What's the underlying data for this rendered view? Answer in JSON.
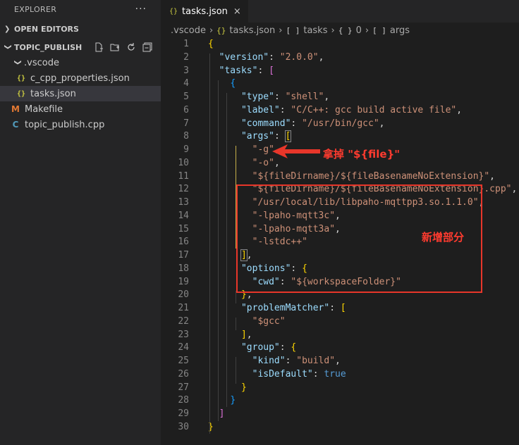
{
  "sidebar": {
    "title": "EXPLORER",
    "more": "···",
    "open_editors": "OPEN EDITORS",
    "project": "TOPIC_PUBLISH",
    "tree": [
      {
        "label": ".vscode",
        "type": "folder"
      },
      {
        "label": "c_cpp_properties.json",
        "type": "json"
      },
      {
        "label": "tasks.json",
        "type": "json"
      },
      {
        "label": "Makefile",
        "type": "makefile"
      },
      {
        "label": "topic_publish.cpp",
        "type": "cpp"
      }
    ]
  },
  "tab": {
    "label": "tasks.json",
    "close": "×"
  },
  "breadcrumb": {
    "folder": ".vscode",
    "file": "tasks.json",
    "tasks": "tasks",
    "index": "0",
    "args": "args"
  },
  "icons": {
    "json": "{}",
    "array": "[ ]",
    "obj": "{ }"
  },
  "editor": {
    "line_numbers": [
      "1",
      "2",
      "3",
      "4",
      "5",
      "6",
      "7",
      "8",
      "9",
      "10",
      "11",
      "12",
      "13",
      "14",
      "15",
      "16",
      "17",
      "18",
      "19",
      "20",
      "21",
      "22",
      "23",
      "24",
      "25",
      "26",
      "27",
      "28",
      "29",
      "30"
    ],
    "strings": {
      "version_key": "\"version\"",
      "version_val": "\"2.0.0\"",
      "tasks_key": "\"tasks\"",
      "type_key": "\"type\"",
      "type_val": "\"shell\"",
      "label_key": "\"label\"",
      "label_val": "\"C/C++: gcc build active file\"",
      "command_key": "\"command\"",
      "command_val": "\"/usr/bin/gcc\"",
      "args_key": "\"args\"",
      "arg_g": "\"-g\"",
      "arg_o": "\"-o\"",
      "arg_out": "\"${fileDirname}/${fileBasenameNoExtension}\"",
      "arg_src": "\"${fileDirname}/${fileBasenameNoExtension}.cpp\"",
      "arg_lib": "\"/usr/local/lib/libpaho-mqttpp3.so.1.1.0\"",
      "arg_l3c": "\"-lpaho-mqtt3c\"",
      "arg_l3a": "\"-lpaho-mqtt3a\"",
      "arg_stdc": "\"-lstdc++\"",
      "options_key": "\"options\"",
      "cwd_key": "\"cwd\"",
      "cwd_val": "\"${workspaceFolder}\"",
      "pm_key": "\"problemMatcher\"",
      "pm_val": "\"$gcc\"",
      "group_key": "\"group\"",
      "kind_key": "\"kind\"",
      "kind_val": "\"build\"",
      "default_key": "\"isDefault\"",
      "default_val": "true"
    }
  },
  "annotations": {
    "remove_note": "拿掉 \"${file}\"",
    "added_note": "新增部分"
  },
  "colors": {
    "annotation": "#e8362a",
    "string": "#ce9178",
    "key": "#9cdcfe"
  }
}
